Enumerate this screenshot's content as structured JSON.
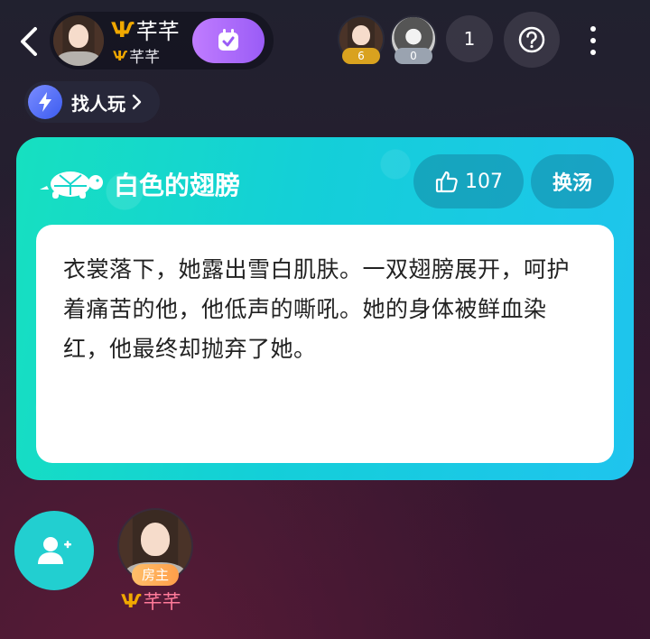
{
  "header": {
    "host_name": "芊芊",
    "host_sub": "芊芊",
    "viewers": [
      {
        "count": "6",
        "badge_color": "#d9a21f"
      },
      {
        "count": "0",
        "badge_color": "#9aa3b0"
      }
    ],
    "online_count": "1"
  },
  "find_button": {
    "label": "找人玩"
  },
  "card": {
    "title": "白色的翅膀",
    "likes": "107",
    "swap_label": "换汤",
    "story": "衣裳落下，她露出雪白肌肤。一双翅膀展开，呵护着痛苦的他，他低声的嘶吼。她的身体被鲜血染红，他最终却抛弃了她。"
  },
  "seat": {
    "role": "房主",
    "name": "芊芊"
  },
  "colors": {
    "accent_purple": "#9a5cf6",
    "card_teal": "#16e0c0",
    "card_blue": "#1fc4ee",
    "host_name_pink": "#ff7a9a",
    "badge_orange": "#ff9f4a"
  }
}
